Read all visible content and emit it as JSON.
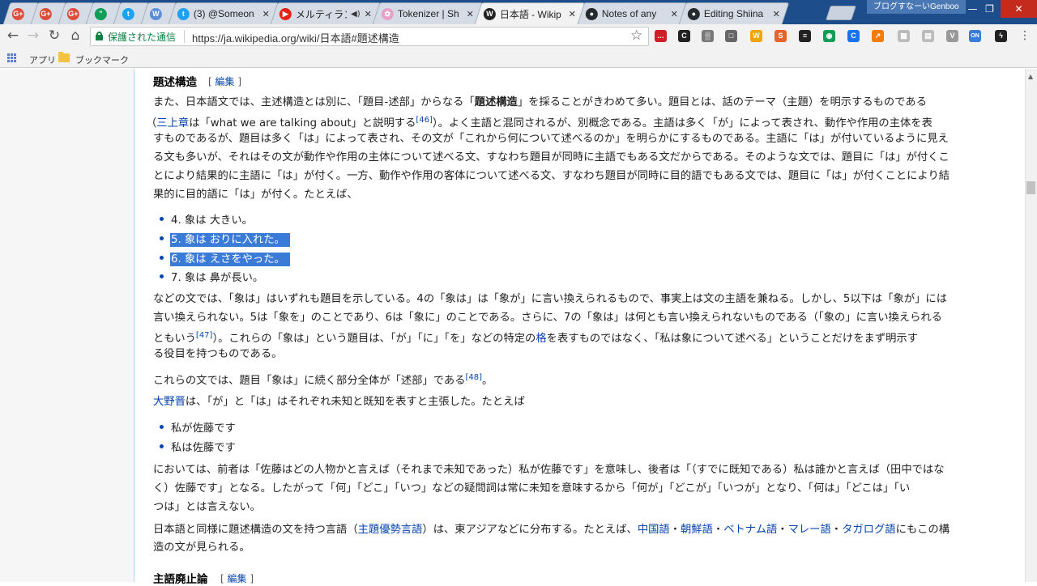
{
  "browser": {
    "tabs": [
      {
        "icon": "google-plus-icon",
        "glyph": "G+",
        "color": "#dd4b39",
        "title": ""
      },
      {
        "icon": "google-plus-icon",
        "glyph": "G+",
        "color": "#dd4b39",
        "title": ""
      },
      {
        "icon": "google-plus-icon",
        "glyph": "G+",
        "color": "#dd4b39",
        "title": ""
      },
      {
        "icon": "hangouts-icon",
        "glyph": "”",
        "color": "#0f9d58",
        "title": ""
      },
      {
        "icon": "twitter-icon",
        "glyph": "t",
        "color": "#1da1f2",
        "title": ""
      },
      {
        "icon": "app-icon",
        "glyph": "W",
        "color": "#5a8fd8",
        "title": ""
      },
      {
        "icon": "twitter-icon",
        "glyph": "t",
        "color": "#1da1f2",
        "title": "(3) @Someon"
      },
      {
        "icon": "youtube-icon",
        "glyph": "▶",
        "color": "#e62117",
        "title": "メルティランド"
      },
      {
        "icon": "tokenizer-icon",
        "glyph": "✿",
        "color": "#e8a0c8",
        "title": "Tokenizer | Sh"
      },
      {
        "icon": "wikipedia-icon",
        "glyph": "W",
        "color": "#222222",
        "title": "日本語 - Wikip"
      },
      {
        "icon": "github-icon",
        "glyph": "●",
        "color": "#24292e",
        "title": "Notes of any"
      },
      {
        "icon": "github-icon",
        "glyph": "●",
        "color": "#24292e",
        "title": "Editing Shiina"
      }
    ],
    "profile_name": "ブログすなーいGenboo",
    "secure_label": "保護された通信",
    "url": "https://ja.wikipedia.org/wiki/日本語#題述構造",
    "bookmarks": {
      "apps": "アプリ",
      "bookmarks": "ブックマーク"
    },
    "extensions": [
      {
        "icon": "lastpass-icon",
        "glyph": "…",
        "color": "#cc2029"
      },
      {
        "icon": "extension-c-icon",
        "glyph": "C",
        "color": "#222222"
      },
      {
        "icon": "qr-icon",
        "glyph": "▒",
        "color": "#777777"
      },
      {
        "icon": "cast-icon",
        "glyph": "□",
        "color": "#666666"
      },
      {
        "icon": "extension-w-icon",
        "glyph": "W",
        "color": "#f0a30a"
      },
      {
        "icon": "extension-s-icon",
        "glyph": "S",
        "color": "#e8632a"
      },
      {
        "icon": "buffer-icon",
        "glyph": "≡",
        "color": "#222222"
      },
      {
        "icon": "extension-eye-icon",
        "glyph": "◉",
        "color": "#0f9d58"
      },
      {
        "icon": "extension-c2-icon",
        "glyph": "C",
        "color": "#1a73e8"
      },
      {
        "icon": "extension-chart-icon",
        "glyph": "↗",
        "color": "#f57c00"
      },
      {
        "icon": "extension-gray-icon",
        "glyph": "▦",
        "color": "#bbbbbb"
      },
      {
        "icon": "extension-gray2-icon",
        "glyph": "▤",
        "color": "#bbbbbb"
      },
      {
        "icon": "extension-v-icon",
        "glyph": "V",
        "color": "#999999"
      },
      {
        "icon": "extension-on-icon",
        "glyph": "ON",
        "color": "#3b7bd8"
      },
      {
        "icon": "extension-bolt-icon",
        "glyph": "ϟ",
        "color": "#222222"
      }
    ]
  },
  "article": {
    "section_title": "題述構造",
    "edit_label": "編集",
    "p1": {
      "l1_pre": "また、日本語文では、主述構造とは別に、「題目-述部」からなる「",
      "l1_bold": "題述構造",
      "l1_post": "」を採ることがきわめて多い。題目とは、話のテーマ（主題）を明示するものである",
      "l2_pre": "（",
      "l2_link": "三上章",
      "l2_mid": "は「what we are talking about」と説明する",
      "l2_ref": "[46]",
      "l2_post": "）。よく主語と混同されるが、別概念である。主語は多く「が」によって表され、動作や作用の主体を表",
      "l3": "すものであるが、題目は多く「は」によって表され、その文が「これから何について述べるのか」を明らかにするものである。主語に「は」が付いているように見え",
      "l4": "る文も多いが、それはその文が動作や作用の主体について述べる文、すなわち題目が同時に主語でもある文だからである。そのような文では、題目に「は」が付くこ",
      "l5": "とにより結果的に主語に「は」が付く。一方、動作や作用の客体について述べる文、すなわち題目が同時に目的語でもある文では、題目に「は」が付くことにより結",
      "l6": "果的に目的語に「は」が付く。たとえば、"
    },
    "list1": [
      {
        "text": "4. 象は 大きい。",
        "selected": false
      },
      {
        "text": "5. 象は おりに入れた。",
        "selected": true
      },
      {
        "text": "6. 象は えさをやった。",
        "selected": true
      },
      {
        "text": "7. 象は 鼻が長い。",
        "selected": false
      }
    ],
    "p2": {
      "l1": "などの文では、「象は」はいずれも題目を示している。4の「象は」は「象が」に言い換えられるもので、事実上は文の主語を兼ねる。しかし、5以下は「象が」には",
      "l2": "言い換えられない。5は「象を」のことであり、6は「象に」のことである。さらに、7の「象は」は何とも言い換えられないものである（「象の」に言い換えられる",
      "l3_pre": "ともいう",
      "l3_ref": "[47]",
      "l3_mid": "）。これらの「象は」という題目は、「が」「に」「を」などの特定の",
      "l3_link": "格",
      "l3_post": "を表すものではなく、「私は象について述べる」ということだけをまず明示す",
      "l4": "る役目を持つものである。"
    },
    "p3": {
      "pre": "これらの文では、題目「象は」に続く部分全体が「述部」である",
      "ref": "[48]",
      "post": "。"
    },
    "p4": {
      "link": "大野晋",
      "post": "は、「が」と「は」はそれぞれ未知と既知を表すと主張した。たとえば"
    },
    "list2": [
      {
        "text": "私が佐藤です"
      },
      {
        "text": "私は佐藤です"
      }
    ],
    "p5": {
      "l1": "においては、前者は「佐藤はどの人物かと言えば（それまで未知であった）私が佐藤です」を意味し、後者は「（すでに既知である）私は誰かと言えば（田中ではな",
      "l2": "く）佐藤です」となる。したがって「何」「どこ」「いつ」などの疑問詞は常に未知を意味するから「何が」「どこが」「いつが」となり、「何は」「どこは」「い",
      "l3": "つは」とは言えない。"
    },
    "p6": {
      "pre": "日本語と同様に題述構造の文を持つ言語（",
      "link1": "主題優勢言語",
      "mid": "）は、東アジアなどに分布する。たとえば、",
      "link2": "中国語",
      "dot": "・",
      "link3": "朝鮮語",
      "link4": "ベトナム語",
      "link5": "マレー語",
      "link6": "タガログ語",
      "post": "にもこの構",
      "l2": "造の文が見られる。"
    },
    "next_section_title": "主語廃止論",
    "next_edit_label": "編集"
  }
}
